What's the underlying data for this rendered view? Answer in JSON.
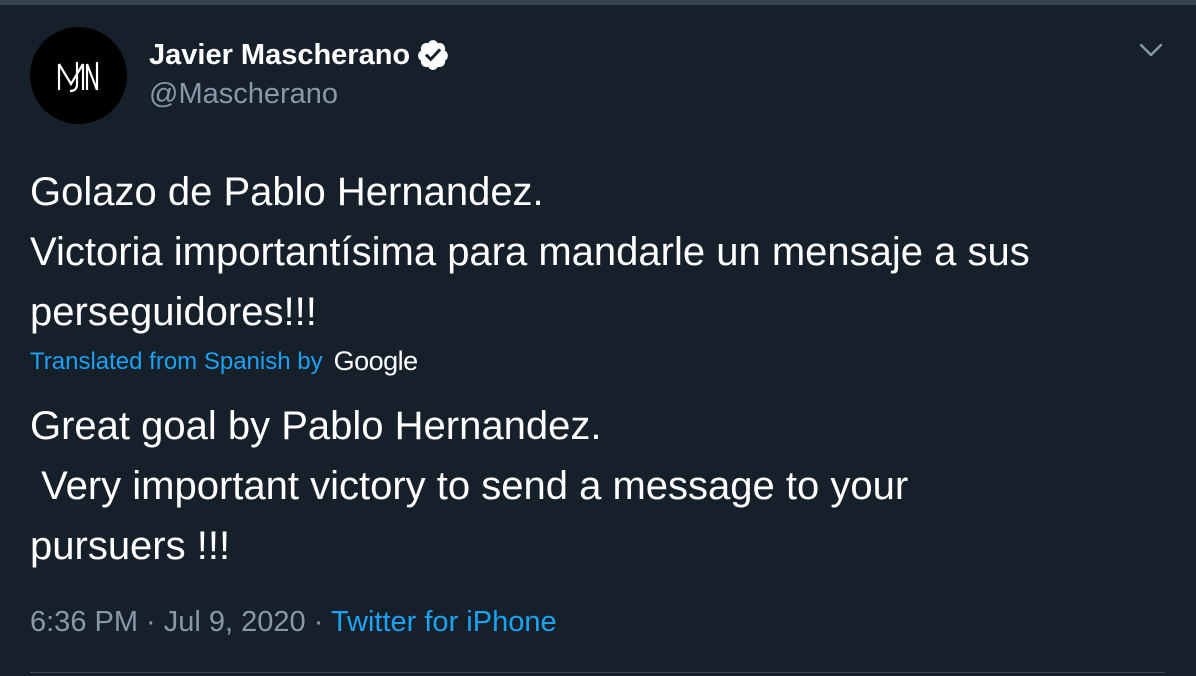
{
  "author": {
    "name": "Javier Mascherano",
    "handle": "@Mascherano",
    "avatar_monogram": "MJ",
    "verified": true
  },
  "icons": {
    "verified": "verified-badge-icon",
    "menu": "chevron-down-icon"
  },
  "tweet": {
    "lines": [
      "Golazo de Pablo Hernandez.",
      "Victoria importantísima para mandarle un mensaje a sus",
      "perseguidores!!!"
    ]
  },
  "translation": {
    "label": "Translated from Spanish by",
    "provider": "Google",
    "lines": [
      "Great goal by Pablo Hernandez.",
      " Very important victory to send a message to your",
      "pursuers !!!"
    ]
  },
  "meta": {
    "time": "6:36 PM",
    "separator": " · ",
    "date": "Jul 9, 2020",
    "source": "Twitter for iPhone"
  },
  "colors": {
    "background": "#15202b",
    "accent": "#1da1f2",
    "muted": "#8899a6",
    "border": "#38444d"
  }
}
